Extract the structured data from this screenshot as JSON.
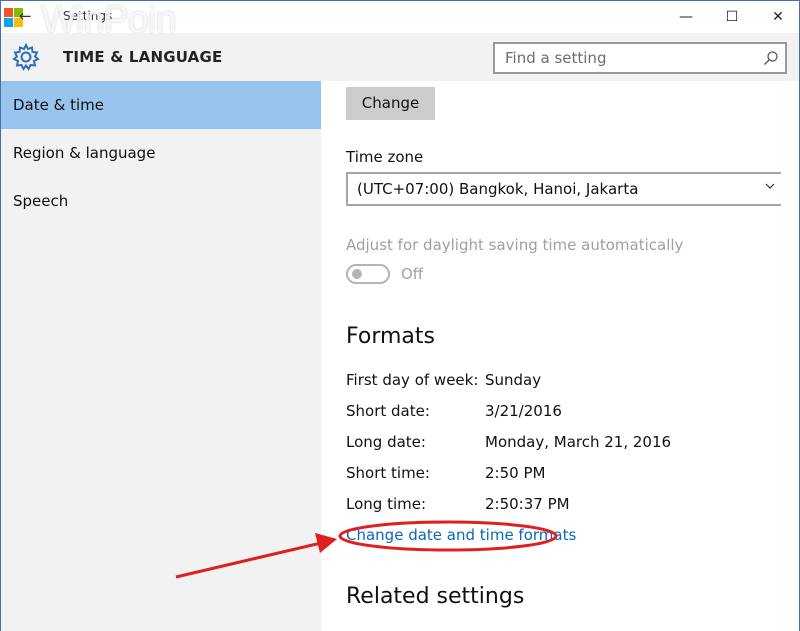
{
  "window": {
    "title": "Settings",
    "watermark": "WinPoin",
    "minimize_glyph": "—",
    "maximize_glyph": "☐",
    "close_glyph": "✕"
  },
  "header": {
    "section_title": "TIME & LANGUAGE",
    "search_placeholder": "Find a setting"
  },
  "sidebar": {
    "items": [
      {
        "label": "Date & time",
        "active": true
      },
      {
        "label": "Region & language",
        "active": false
      },
      {
        "label": "Speech",
        "active": false
      }
    ]
  },
  "main": {
    "change_button": "Change",
    "time_zone_label": "Time zone",
    "time_zone_value": "(UTC+07:00) Bangkok, Hanoi, Jakarta",
    "dst_label": "Adjust for daylight saving time automatically",
    "dst_toggle_state": "Off",
    "formats_heading": "Formats",
    "formats": [
      {
        "key": "First day of week:",
        "value": "Sunday"
      },
      {
        "key": "Short date:",
        "value": "3/21/2016"
      },
      {
        "key": "Long date:",
        "value": "Monday, March 21, 2016"
      },
      {
        "key": "Short time:",
        "value": "2:50 PM"
      },
      {
        "key": "Long time:",
        "value": "2:50:37 PM"
      }
    ],
    "change_formats_link": "Change date and time formats",
    "related_heading": "Related settings"
  },
  "colors": {
    "accent_active": "#99c4ee",
    "link": "#0a68b9",
    "annotation_red": "#e02020"
  }
}
